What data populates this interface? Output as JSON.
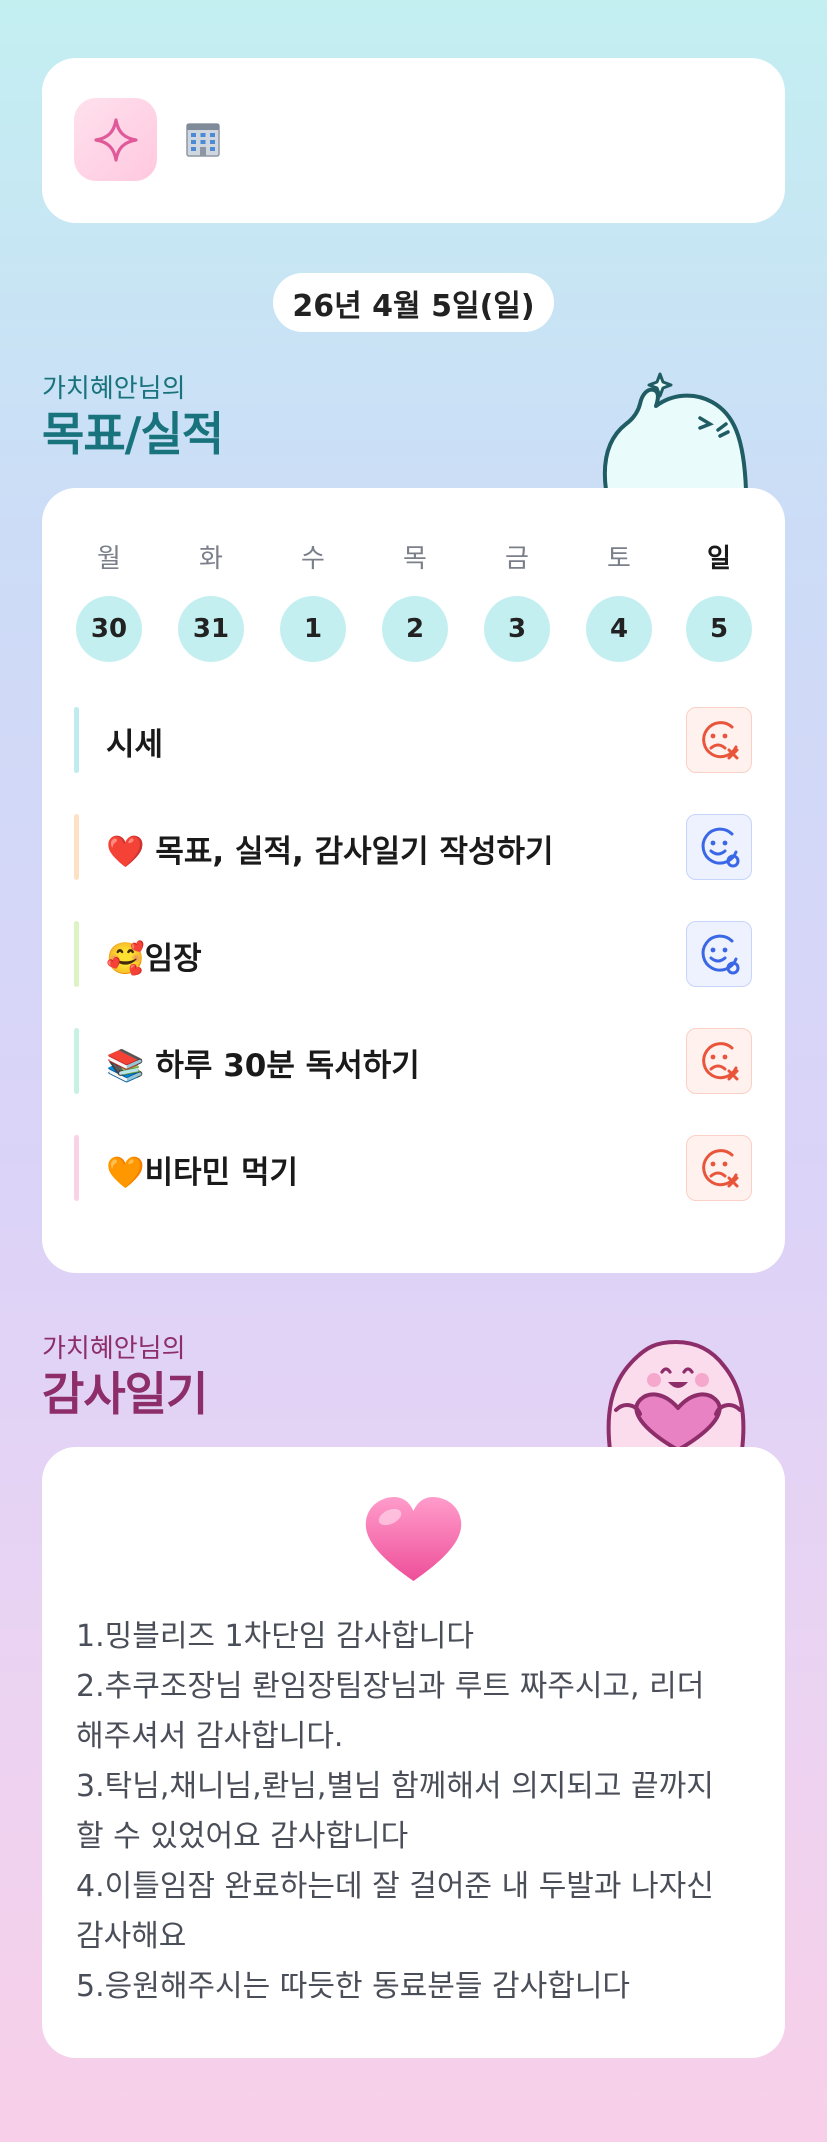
{
  "header": {
    "app_icon": "sparkle-icon",
    "building_icon": "office-building-icon"
  },
  "date": "26년 4월 5일(일)",
  "goals_section": {
    "owner": "가치혜안님의",
    "title": "목표/실적"
  },
  "week": {
    "days": [
      "월",
      "화",
      "수",
      "목",
      "금",
      "토",
      "일"
    ],
    "dates": [
      "30",
      "31",
      "1",
      "2",
      "3",
      "4",
      "5"
    ]
  },
  "goals": [
    {
      "label": "시세",
      "bar_color": "#bfecee",
      "status": "fail"
    },
    {
      "label": "❤️ 목표, 실적, 감사일기 작성하기",
      "bar_color": "#fde1c4",
      "status": "done"
    },
    {
      "label": "🥰임장",
      "bar_color": "#dcf3c2",
      "status": "done"
    },
    {
      "label": "📚 하루 30분 독서하기",
      "bar_color": "#c7f2e2",
      "status": "fail"
    },
    {
      "label": "🧡비타민 먹기",
      "bar_color": "#f9d2e8",
      "status": "fail"
    }
  ],
  "diary_section": {
    "owner": "가치혜안님의",
    "title": "감사일기"
  },
  "diary": {
    "lines": [
      "1.밍블리즈 1차단임 감사합니다",
      "2.추쿠조장님 롼임장팀장님과 루트 짜주시고, 리더",
      "해주셔서 감사합니다.",
      "3.탁님,채니님,롼님,별님 함께해서 의지되고 끝까지",
      "할 수 있었어요 감사합니다",
      "4.이틀임잠 완료하는데 잘 걸어준 내 두발과 나자신",
      "감사해요",
      "5.응원해주시는 따듯한 동료분들 감사합니다"
    ]
  },
  "colors": {
    "goals_title": "#18737d",
    "diary_title": "#8d2e6b",
    "daynum_bg": "#c4eff1",
    "status_fail": "#e8553b",
    "status_done": "#3a67e6"
  }
}
